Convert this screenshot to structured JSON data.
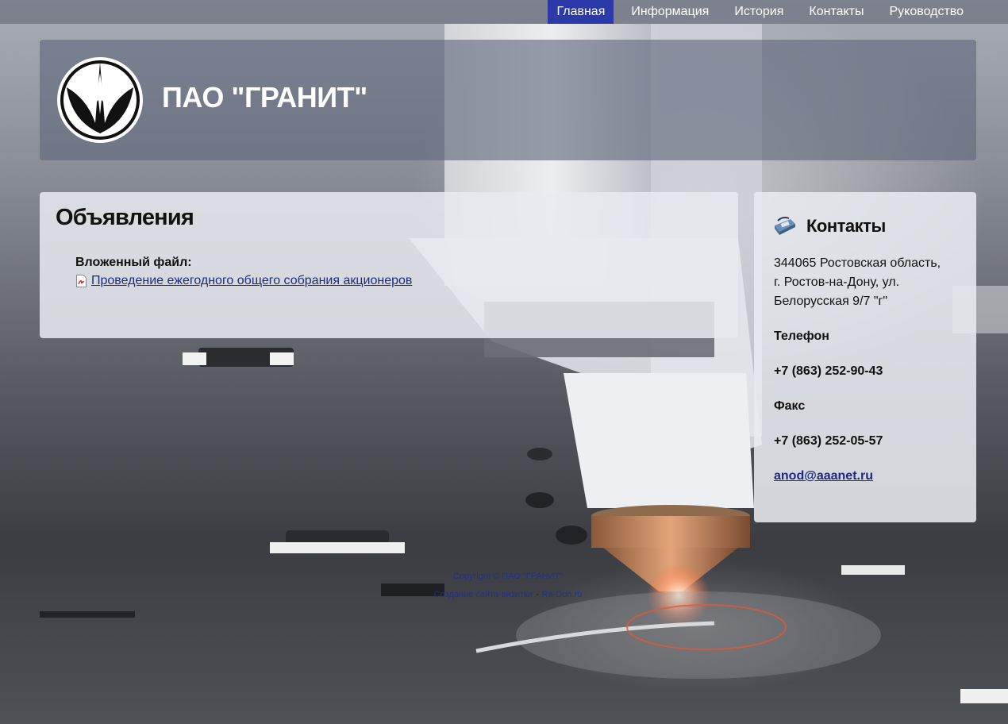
{
  "nav": {
    "items": [
      {
        "label": "Главная",
        "active": true
      },
      {
        "label": "Информация",
        "active": false
      },
      {
        "label": "История",
        "active": false
      },
      {
        "label": "Контакты",
        "active": false
      },
      {
        "label": "Руководство",
        "active": false
      }
    ]
  },
  "header": {
    "site_title": "ПАО \"ГРАНИТ\""
  },
  "main": {
    "title": "Объявления",
    "attachment_label": "Вложенный файл:",
    "attachment_link": "Проведение ежегодного общего собрания акционеров",
    "attachment_icon": "pdf-icon"
  },
  "sidebar": {
    "icon": "phone-icon",
    "title": "Контакты",
    "address_line1": "344065 Ростовская область,",
    "address_line2": "г. Ростов-на-Дону, ул.",
    "address_line3": "Белорусская 9/7 \"г\"",
    "phone_label": "Телефон",
    "phone_value": "+7 (863) 252-90-43",
    "fax_label": "Факс",
    "fax_value": "+7 (863) 252-05-57",
    "email": "anod@aaanet.ru"
  },
  "footer": {
    "copyright": "Copyright © ПАО \"ГРАНИТ\"",
    "made_label": "Создание сайта-визитки",
    "separator": "-",
    "made_by": "Ra-Don.ru"
  },
  "colors": {
    "nav_active": "#2b3aa8",
    "link": "#1e2a80"
  }
}
